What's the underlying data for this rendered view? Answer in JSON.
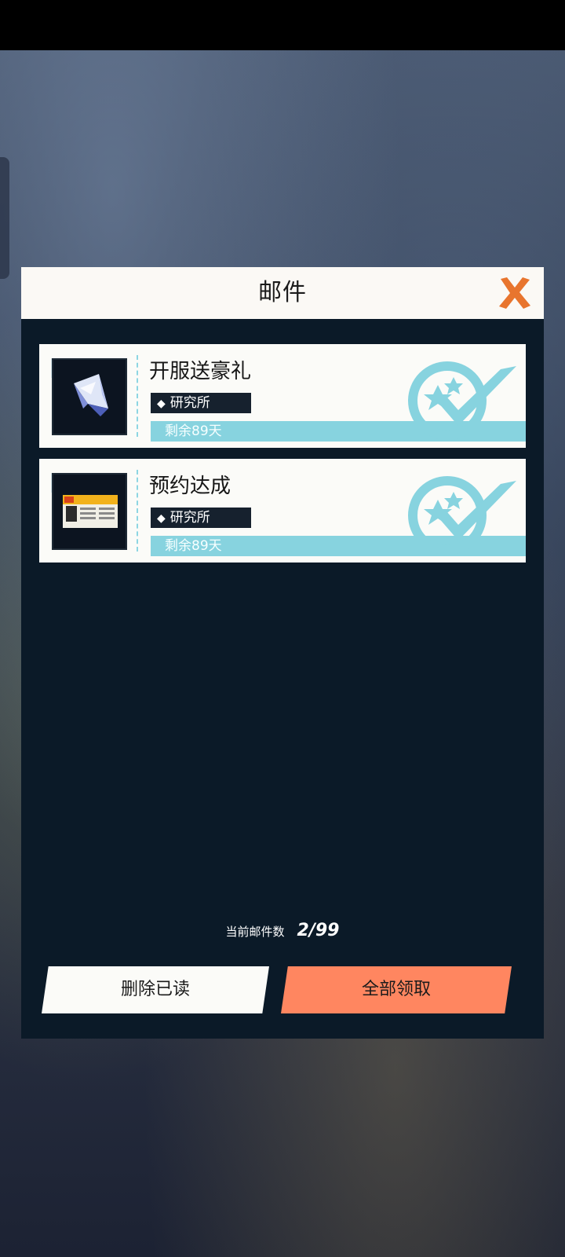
{
  "dialog": {
    "title": "邮件",
    "close_icon": "close-x-icon"
  },
  "mails": [
    {
      "title": "开服送豪礼",
      "sender": "研究所",
      "expire": "剩余89天",
      "thumb_icon": "diamond-crystal-icon",
      "status_icon": "claimed-check-icon"
    },
    {
      "title": "预约达成",
      "sender": "研究所",
      "expire": "剩余89天",
      "thumb_icon": "ticket-card-icon",
      "status_icon": "claimed-check-icon"
    }
  ],
  "footer": {
    "count_label": "当前邮件数",
    "count_value": "2/99",
    "delete_read_label": "删除已读",
    "claim_all_label": "全部领取"
  },
  "colors": {
    "header_bg": "#fbf9f5",
    "dialog_bg": "#0b1a28",
    "accent_cyan": "#87d3df",
    "claim_orange": "#ff8660",
    "close_orange": "#e8752e"
  }
}
